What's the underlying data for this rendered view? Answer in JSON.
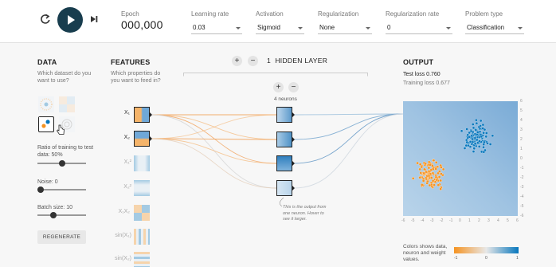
{
  "controls": {
    "epoch_label": "Epoch",
    "epoch_value": "000,000"
  },
  "settings": [
    {
      "label": "Learning rate",
      "value": "0.03"
    },
    {
      "label": "Activation",
      "value": "Sigmoid"
    },
    {
      "label": "Regularization",
      "value": "None"
    },
    {
      "label": "Regularization rate",
      "value": "0"
    },
    {
      "label": "Problem type",
      "value": "Classification"
    }
  ],
  "data_panel": {
    "title": "DATA",
    "question": "Which dataset do you want to use?",
    "ratio_label": "Ratio of training to test data:",
    "ratio_value": "50%",
    "ratio_fraction": 0.5,
    "noise_label": "Noise:",
    "noise_value": "0",
    "noise_fraction": 0,
    "batch_label": "Batch size:",
    "batch_value": "10",
    "batch_fraction": 0.3,
    "regenerate_label": "REGENERATE"
  },
  "features_panel": {
    "title": "FEATURES",
    "question": "Which properties do you want to feed in?",
    "features": [
      {
        "label": "X₁",
        "active": true
      },
      {
        "label": "X₂",
        "active": true
      },
      {
        "label": "X₁²",
        "active": false
      },
      {
        "label": "X₂²",
        "active": false
      },
      {
        "label": "X₁X₂",
        "active": false
      },
      {
        "label": "sin(X₁)",
        "active": false
      },
      {
        "label": "sin(X₂)",
        "active": false
      }
    ]
  },
  "network": {
    "layer_count": "1",
    "layers_label": "HIDDEN LAYER",
    "neurons_label": "4 neurons",
    "add_layer": "+",
    "remove_layer": "−",
    "add_neuron": "+",
    "remove_neuron": "−",
    "hover_note": "This is the output from one neuron. Hover to see it larger."
  },
  "output_panel": {
    "title": "OUTPUT",
    "test_loss": "Test loss 0.760",
    "training_loss": "Training loss 0.677",
    "legend_text": "Colors shows data, neuron and weight values.",
    "legend_ticks": [
      "-1",
      "0",
      "1"
    ],
    "axis_right": [
      "6",
      "5",
      "4",
      "3",
      "2",
      "1",
      "0",
      "-1",
      "-2",
      "-3",
      "-4",
      "-5",
      "-6"
    ],
    "axis_bottom": [
      "-6",
      "-5",
      "-4",
      "-3",
      "-2",
      "-1",
      "0",
      "1",
      "2",
      "3",
      "4",
      "5",
      "6"
    ]
  },
  "colors": {
    "orange": "#f59322",
    "blue": "#0877bd",
    "play_button": "#183d4e"
  }
}
